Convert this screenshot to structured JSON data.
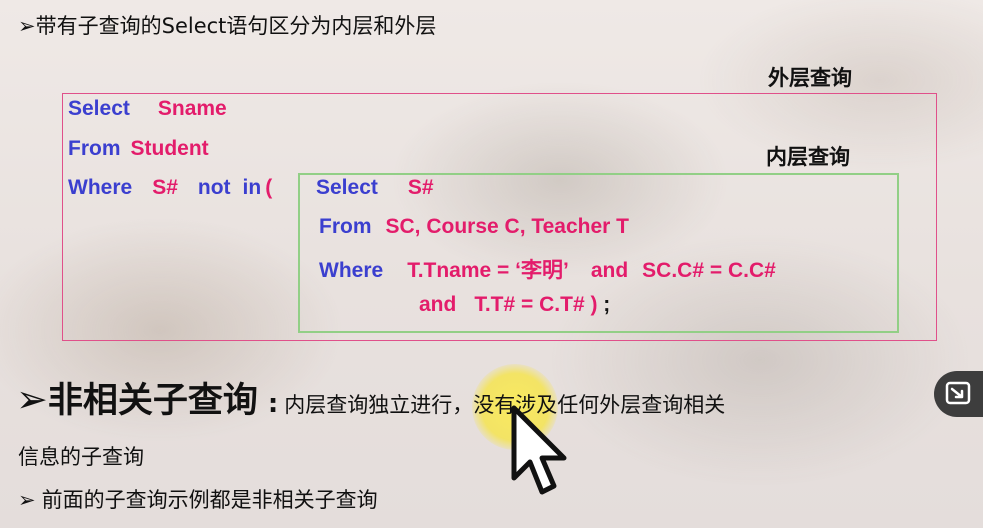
{
  "bullet1": {
    "arrow": "➢",
    "text": "带有子查询的Select语句区分为内层和外层"
  },
  "labels": {
    "outer": "外层查询",
    "inner": "内层查询"
  },
  "code": {
    "l1": {
      "kw": "Select",
      "id": "Sname"
    },
    "l2": {
      "kw": "From",
      "id": "Student"
    },
    "l3": {
      "kw": "Where",
      "id1": "S#",
      "kw2": "not",
      "kw3": "in",
      "paren": "("
    },
    "l3b": {
      "kw": "Select",
      "id": "S#"
    },
    "l4": {
      "kw": "From",
      "id": "SC, Course  C, Teacher  T"
    },
    "l5": {
      "kw": "Where",
      "id1": "T.Tname = ‘李明’",
      "kw2": "and",
      "id2": "SC.C# = C.C#"
    },
    "l6": {
      "kw": "and",
      "id": "T.T# = C.T# )",
      "tail": " ;"
    }
  },
  "heading": {
    "arrow": "➢",
    "title": "非相关子查询",
    "colon": ":",
    "desc": "内层查询独立进行，没有涉及任何外层查询相关",
    "desc_cont": "信息的子查询"
  },
  "bullet2": {
    "arrow": "➢",
    "text": "前面的子查询示例都是非相关子查询"
  },
  "colors": {
    "keyword": "#3b3fcf",
    "identifier": "#e31c6b",
    "outer_border": "#e0508a",
    "inner_border": "#92cf86",
    "highlight": "#f5e450"
  },
  "icons": {
    "cursor": "mouse-pointer-icon",
    "side": "exit-fullscreen-icon"
  }
}
